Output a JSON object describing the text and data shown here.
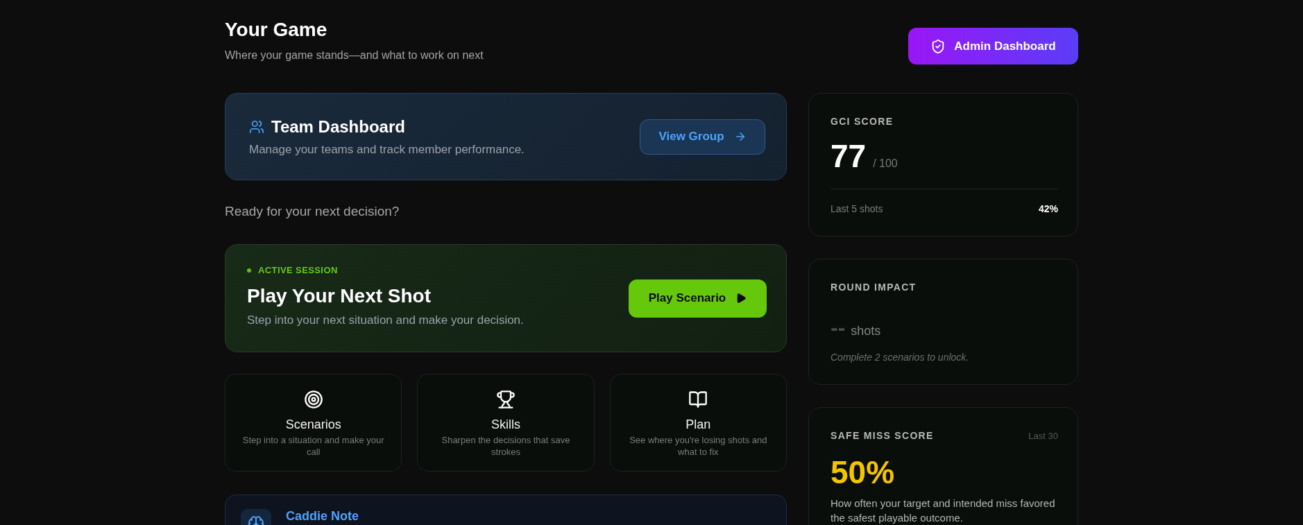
{
  "header": {
    "title": "Your Game",
    "subtitle": "Where your game stands—and what to work on next",
    "action": {
      "label": "Admin Dashboard"
    }
  },
  "team_card": {
    "title": "Team Dashboard",
    "description": "Manage your teams and track member performance.",
    "button": {
      "label": "View Group"
    }
  },
  "prompt": "Ready for your next decision?",
  "session_card": {
    "status": "ACTIVE SESSION",
    "title": "Play Your Next Shot",
    "description": "Step into your next situation and make your decision.",
    "button": {
      "label": "Play Scenario"
    }
  },
  "tiles": [
    {
      "title": "Scenarios",
      "description": "Step into a situation and make your call"
    },
    {
      "title": "Skills",
      "description": "Sharpen the decisions that save strokes"
    },
    {
      "title": "Plan",
      "description": "See where you're losing shots and what to fix"
    }
  ],
  "caddie_note": {
    "title": "Caddie Note"
  },
  "stats": [
    {
      "kind": "score",
      "label": "GCI SCORE",
      "value": "77",
      "max": "/ 100",
      "footer_label": "Last 5 shots",
      "footer_value": "42%"
    },
    {
      "kind": "locked",
      "label": "ROUND IMPACT",
      "value": "--",
      "unit": "shots",
      "note": "Complete 2 scenarios to unlock."
    },
    {
      "kind": "percent",
      "label": "SAFE MISS SCORE",
      "period": "Last 30",
      "value": "50%",
      "description": "How often your target and intended miss favored the safest playable outcome."
    }
  ]
}
